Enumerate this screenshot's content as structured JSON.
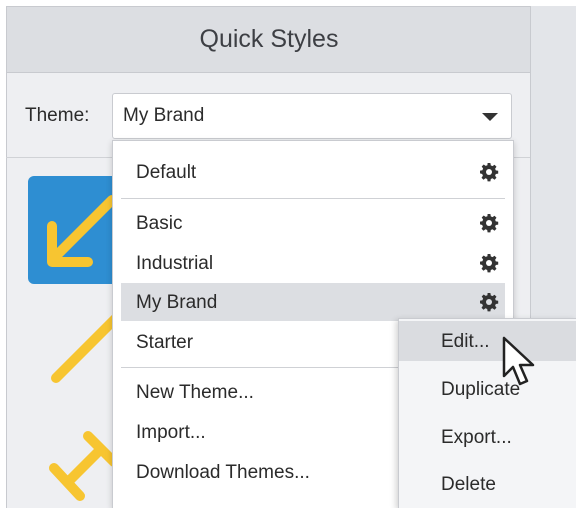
{
  "panel": {
    "title": "Quick Styles"
  },
  "theme": {
    "label": "Theme:",
    "selected": "My Brand"
  },
  "menu": {
    "items": [
      {
        "label": "Default",
        "gear_icon": "gear-icon"
      },
      {
        "label": "Basic",
        "gear_icon": "gear-icon"
      },
      {
        "label": "Industrial",
        "gear_icon": "gear-icon"
      },
      {
        "label": "My Brand",
        "gear_icon": "gear-icon",
        "selected": true
      },
      {
        "label": "Starter"
      },
      {
        "label": "New Theme..."
      },
      {
        "label": "Import..."
      },
      {
        "label": "Download Themes..."
      }
    ]
  },
  "submenu": {
    "items": [
      {
        "label": "Edit...",
        "hover": true
      },
      {
        "label": "Duplicate"
      },
      {
        "label": "Export..."
      },
      {
        "label": "Delete"
      }
    ]
  },
  "colors": {
    "accent_blue": "#2e8ed2",
    "arrow_yellow": "#f7c531",
    "selection_gray": "#dcdee2"
  },
  "icons": {
    "dropdown": "chevron-down-icon",
    "cursor": "mouse-pointer-icon"
  }
}
